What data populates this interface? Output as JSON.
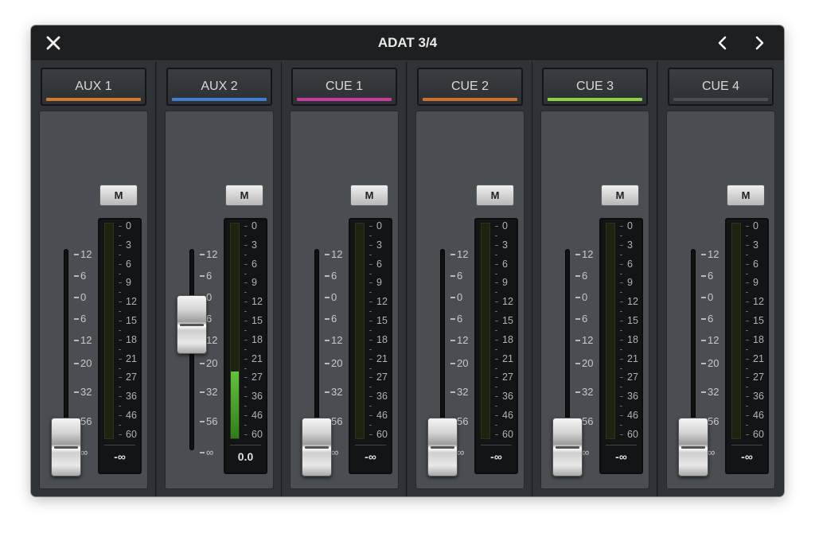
{
  "window": {
    "title": "ADAT 3/4"
  },
  "titlebar_icons": {
    "close": "close-icon",
    "prev": "chevron-left-icon",
    "next": "chevron-right-icon"
  },
  "meter_scale": [
    "0",
    "3",
    "6",
    "9",
    "12",
    "15",
    "18",
    "21",
    "27",
    "36",
    "46",
    "60"
  ],
  "fader_scale": [
    "12",
    "6",
    "0",
    "6",
    "12",
    "20",
    "32",
    "56",
    "∞"
  ],
  "channels": [
    {
      "name": "AUX 1",
      "color": "#d07a2e",
      "mute_label": "M",
      "readout": "-∞",
      "fader_level": 0.0,
      "meter_level": 0.0
    },
    {
      "name": "AUX 2",
      "color": "#3f7fd1",
      "mute_label": "M",
      "readout": "0.0",
      "fader_level": 0.79,
      "meter_level": 0.31
    },
    {
      "name": "CUE 1",
      "color": "#c93aa0",
      "mute_label": "M",
      "readout": "-∞",
      "fader_level": 0.0,
      "meter_level": 0.0
    },
    {
      "name": "CUE 2",
      "color": "#d0702e",
      "mute_label": "M",
      "readout": "-∞",
      "fader_level": 0.0,
      "meter_level": 0.0
    },
    {
      "name": "CUE 3",
      "color": "#8dd13f",
      "mute_label": "M",
      "readout": "-∞",
      "fader_level": 0.0,
      "meter_level": 0.0
    },
    {
      "name": "CUE 4",
      "color": "#4a4d52",
      "mute_label": "M",
      "readout": "-∞",
      "fader_level": 0.0,
      "meter_level": 0.0
    }
  ]
}
